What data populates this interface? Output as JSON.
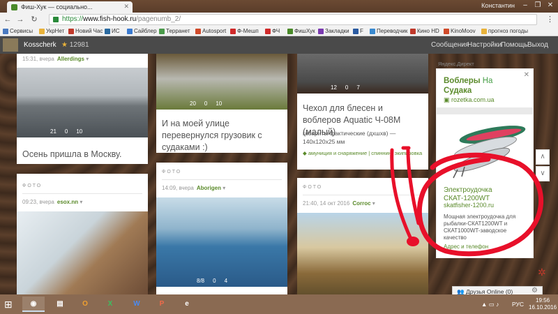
{
  "browser": {
    "tab_title": "Фиш-Хук — социально...",
    "user_name": "Константин",
    "url_host": "www.fish-hook.ru",
    "url_path": "/pagenumb_2/",
    "url_scheme": "https://",
    "bookmarks": [
      "Сервисы",
      "УкрНет",
      "Новий Час",
      "ИС",
      "Сайблер",
      "Терранет",
      "Autosport",
      "Ф-Мешп",
      "ФЧ",
      "ФишХук",
      "Закладки",
      "F",
      "Переводчик",
      "Кино HD",
      "KinoMoov",
      "прогноз погоды"
    ]
  },
  "site": {
    "username": "Kosscherk",
    "rating": "12981",
    "nav": [
      "Сообщения",
      "Настройки",
      "Помощь",
      "Выход"
    ]
  },
  "cards": {
    "c1": {
      "meta_time": "15:31, вчера",
      "author": "Allerdings",
      "comments": "21",
      "likes": "0",
      "views": "10",
      "title": "Осень пришла в Москву."
    },
    "c2": {
      "comments": "20",
      "likes": "0",
      "views": "10",
      "title": "И на моей улице перевернулся грузовик с судаками :)"
    },
    "c3": {
      "comments": "12",
      "likes": "0",
      "views": "7",
      "title": "Чехол для блесен и воблеров Aquatic Ч-08М (малый)",
      "desc": "габариты фактические (дхшхв) — 140х120х25 мм",
      "tags": "амуниция и снаряжение | спиннинг экипировка"
    },
    "c4": {
      "section": "ФОТО",
      "meta_time": "09:23, вчера",
      "author": "esox.nn"
    },
    "c5": {
      "section": "ФОТО",
      "meta_time": "14:09, вчера",
      "author": "Aborigen",
      "comments": "8/8",
      "likes": "0",
      "views": "4"
    },
    "c6": {
      "section": "ФОТО",
      "meta_time": "21:40, 14 окт 2016",
      "author": "Corroc"
    }
  },
  "ads": {
    "label": "Яндекс.Директ",
    "ad1_title_a": "Воблеры",
    "ad1_title_b": "На",
    "ad1_title_c": "Судака",
    "ad1_domain": "rozetka.com.ua",
    "ad2_title": "Электроудочка СКАТ-1200WT",
    "ad2_domain": "skatfisher-1200.ru",
    "ad2_desc": "Мощная электроудочка для рыбалки-СКАТ1200WT и СКАТ1000WT-заводское качество",
    "ad2_link": "Адрес и телефон"
  },
  "widget": {
    "friends_online": "Друзья Online (0)"
  },
  "taskbar": {
    "lang": "РУС",
    "time": "19:56",
    "date": "16.10.2016"
  },
  "colors": {
    "accent_green": "#5a8a2a",
    "header_gray": "#4a4a4a",
    "annotation_red": "#e8102a"
  }
}
